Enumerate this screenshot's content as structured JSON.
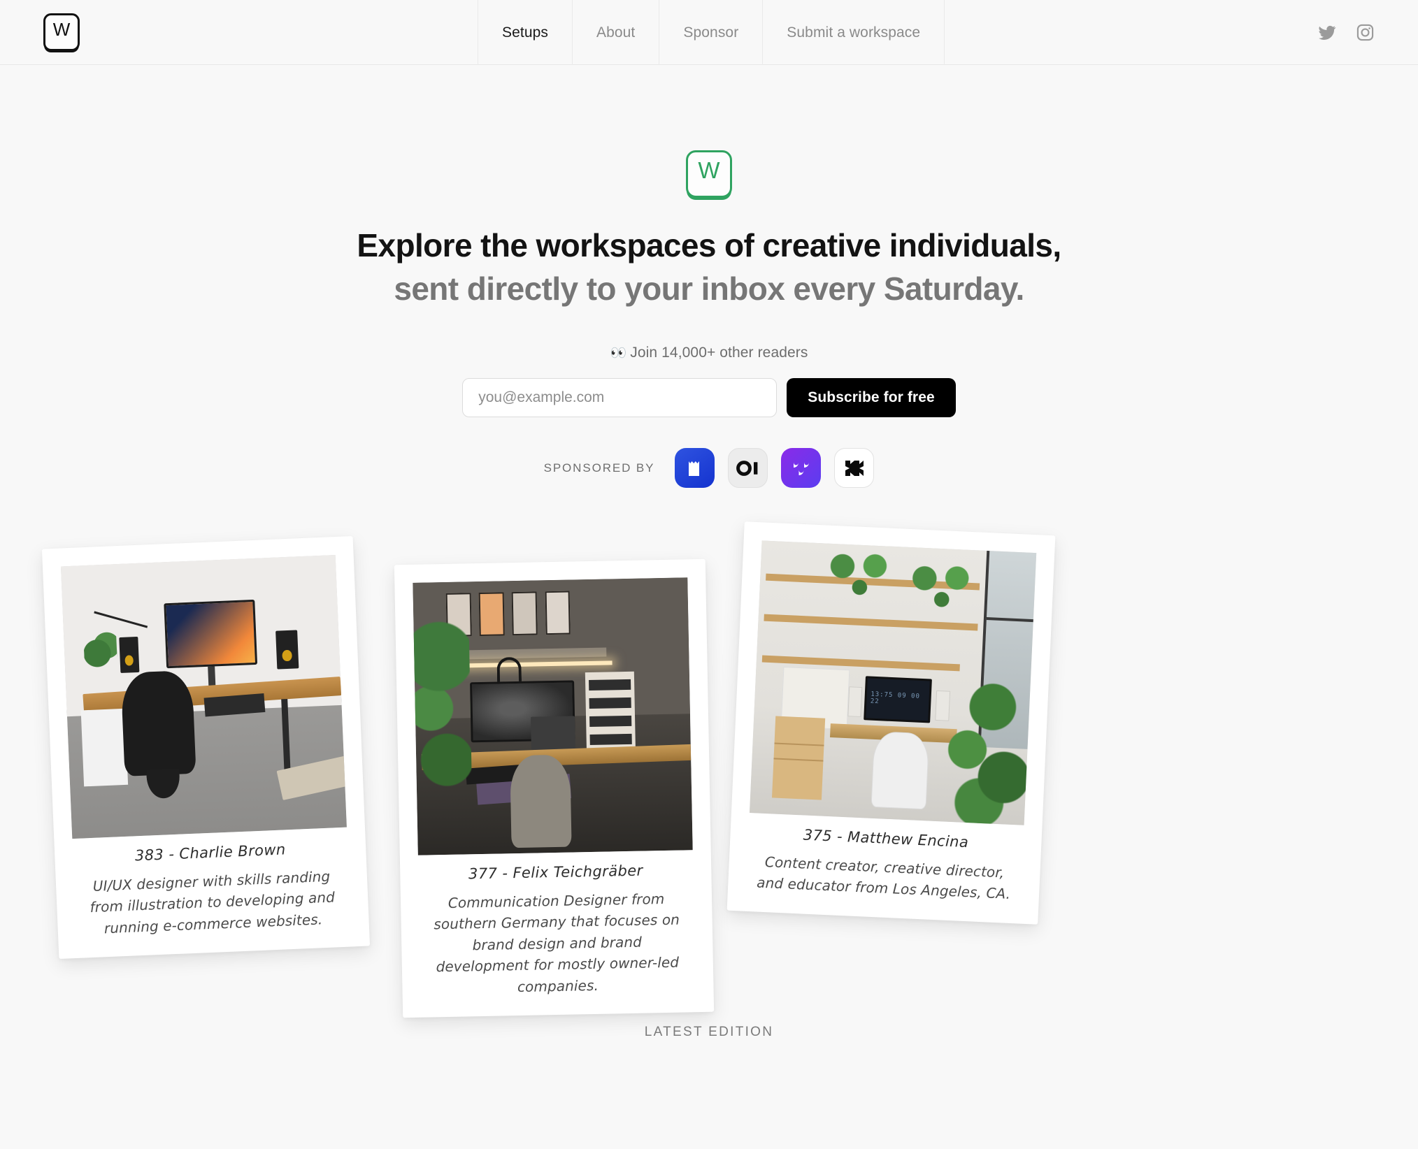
{
  "header": {
    "logo_letter": "W",
    "logo_name": "workspaces-logo",
    "nav": [
      {
        "label": "Setups",
        "active": true
      },
      {
        "label": "About",
        "active": false
      },
      {
        "label": "Sponsor",
        "active": false
      },
      {
        "label": "Submit a workspace",
        "active": false
      }
    ],
    "social": [
      {
        "name": "twitter-icon",
        "label": "Twitter"
      },
      {
        "name": "instagram-icon",
        "label": "Instagram"
      }
    ]
  },
  "hero": {
    "logo_letter": "W",
    "logo_color": "#2fa360",
    "headline_line1": "Explore the workspaces of creative individuals,",
    "headline_line2": "sent directly to your inbox every Saturday.",
    "readers_emoji": "👀",
    "readers_text": "Join 14,000+ other readers",
    "email_placeholder": "you@example.com",
    "email_value": "",
    "subscribe_label": "Subscribe for free"
  },
  "sponsors": {
    "label": "SPONSORED BY",
    "items": [
      {
        "name": "sponsor-bookface",
        "glyph": "book",
        "bg": "#1f3fd4"
      },
      {
        "name": "sponsor-oi",
        "glyph": "OI",
        "bg": "#ececec"
      },
      {
        "name": "sponsor-faces",
        "glyph": "faces",
        "bg": "#7b2fe8"
      },
      {
        "name": "sponsor-x",
        "glyph": "X",
        "bg": "#ffffff"
      }
    ]
  },
  "cards": [
    {
      "title": "383 - Charlie Brown",
      "description": "UI/UX designer with skills randing from illustration to developing and running e-commerce websites.",
      "photo_alt": "bright home office with wooden desk, ultrawide monitor and black chair"
    },
    {
      "title": "377 - Felix Teichgräber",
      "description": "Communication Designer from southern Germany that focuses on brand design and brand development for mostly owner-led companies.",
      "photo_alt": "dark moody workspace with hanging plants, ultrawide monitor and pegboard"
    },
    {
      "title": "375 - Matthew Encina",
      "description": "Content creator, creative director, and educator from Los Angeles, CA.",
      "photo_alt": "bright loft workspace with wooden shelves, many plants and a large window"
    }
  ],
  "footer": {
    "latest_edition_label": "LATEST EDITION"
  }
}
